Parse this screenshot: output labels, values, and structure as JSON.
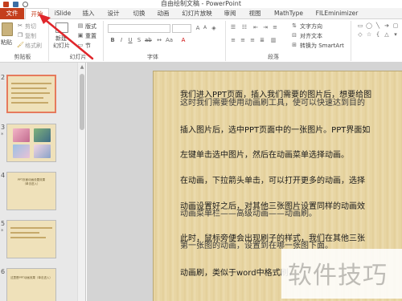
{
  "window": {
    "title": "自由绘制文稿 - PowerPoint"
  },
  "tabs": {
    "file": "文件",
    "home": "开始",
    "islide": "iSlide",
    "insert": "插入",
    "design": "设计",
    "transitions": "切换",
    "animations": "动画",
    "slideshow": "幻灯片放映",
    "review": "审阅",
    "view": "视图",
    "mathtype": "MathType",
    "filminimizer": "FILEminimizer"
  },
  "ribbon": {
    "paste": "粘贴",
    "cut": "剪切",
    "copy": "复制",
    "format_painter": "格式刷",
    "new_slide_line1": "新建",
    "new_slide_line2": "幻灯片",
    "layout": "版式",
    "reset": "重置",
    "section": "节",
    "text_direction": "文字方向",
    "align_text": "对齐文本",
    "smartart": "转换为 SmartArt",
    "groups": {
      "clipboard": "剪贴板",
      "slides": "幻灯片",
      "font": "字体",
      "paragraph": "段落"
    }
  },
  "thumbnails": {
    "items": [
      {
        "num": "2",
        "star": "",
        "text": ""
      },
      {
        "num": "3",
        "star": "*",
        "text": ""
      },
      {
        "num": "4",
        "star": "",
        "text": "PPT页面动画设置效果\n（单击进入）"
      },
      {
        "num": "5",
        "star": "*",
        "text": ""
      },
      {
        "num": "6",
        "star": "",
        "text": "这里是PPT动画效果（单击进入）"
      }
    ]
  },
  "slide": {
    "paragraphs": [
      "我们进入PPT页面，插入我们需要的图片后，想要给图",
      "这时我们需要使用动画刷工具，使可以快速达到目的",
      "插入图片后，选中PPT页面中的一张图片。PPT界面如",
      "左键单击选中图片，然后在动画菜单选择动画。",
      "在动画，下拉箭头单击，可以打开更多的动画，选择",
      "动画设置好之后，对其他三张图片设置同样的动画效",
      "动画菜单栏——高级动画——动画刷。",
      "此时，鼠标旁便会出现刷子的样式，我们在其他三张",
      "第一张图的动画，设置到在哪一张图下面。",
      "动画刷，类似于word中格式刷，"
    ]
  },
  "watermark": {
    "text": "软件技巧"
  },
  "colors": {
    "accent": "#c43e1c",
    "arrow": "#e0262b",
    "slide_bg": "#e9d7a6"
  }
}
